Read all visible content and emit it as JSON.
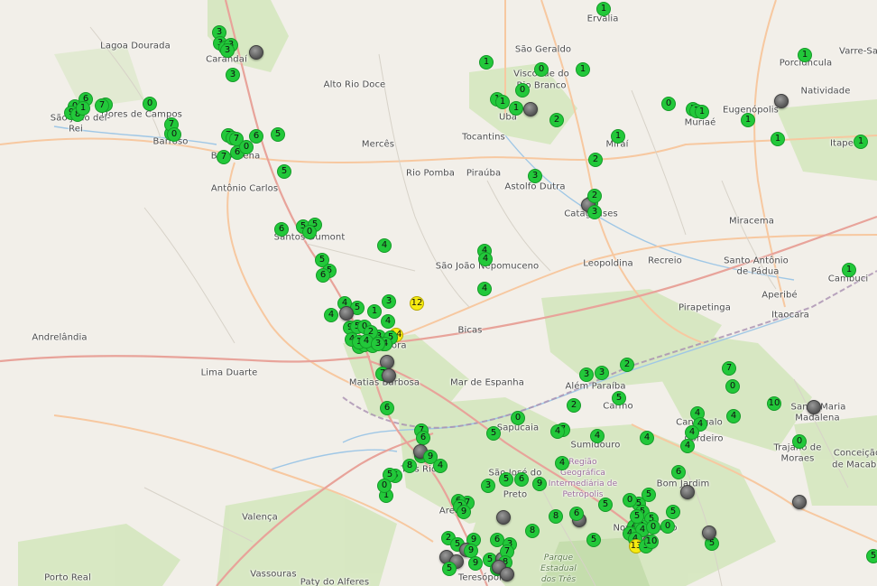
{
  "map": {
    "colors": {
      "land": "#f2efe9",
      "forest": "#cfe5b5",
      "road_major": "#e8a39a",
      "road_trunk": "#f7c8a0",
      "river": "#9fc7e6",
      "boundary": "#9e8ea6",
      "marker_green": "#22c83a",
      "marker_yellow": "#f6ea10",
      "marker_gray": "#5e5e5e"
    },
    "places": [
      {
        "name": "Lagoa Dourada"
      },
      {
        "name": "Carandaí"
      },
      {
        "name": "Alto Rio Doce"
      },
      {
        "name": "São Geraldo"
      },
      {
        "name": "Ervália"
      },
      {
        "name": "Porciúncula"
      },
      {
        "name": "Varre-Sai"
      },
      {
        "name": "Natividade"
      },
      {
        "name": "Visconde do Rio Branco"
      },
      {
        "name": "Dores de Campos"
      },
      {
        "name": "São João del-Rei"
      },
      {
        "name": "Barroso"
      },
      {
        "name": "Barbacena"
      },
      {
        "name": "Mercês"
      },
      {
        "name": "Tocantins"
      },
      {
        "name": "Ubá"
      },
      {
        "name": "Miraí"
      },
      {
        "name": "Muriaé"
      },
      {
        "name": "Eugenópolis"
      },
      {
        "name": "Itaperuna"
      },
      {
        "name": "Rio Pomba"
      },
      {
        "name": "Piraúba"
      },
      {
        "name": "Astolfo Dutra"
      },
      {
        "name": "Antônio Carlos"
      },
      {
        "name": "Cataguases"
      },
      {
        "name": "Miracema"
      },
      {
        "name": "Santos Dumont"
      },
      {
        "name": "São João Nepomuceno"
      },
      {
        "name": "Leopoldina"
      },
      {
        "name": "Recreio"
      },
      {
        "name": "Santo Antônio de Pádua"
      },
      {
        "name": "Cambuci"
      },
      {
        "name": "Aperibé"
      },
      {
        "name": "Itaocara"
      },
      {
        "name": "Pirapetinga"
      },
      {
        "name": "Andrelândia"
      },
      {
        "name": "Bicas"
      },
      {
        "name": "Juiz de Fora"
      },
      {
        "name": "Lima Duarte"
      },
      {
        "name": "Matias Barbosa"
      },
      {
        "name": "Mar de Espanha"
      },
      {
        "name": "Além Paraíba"
      },
      {
        "name": "Carmo"
      },
      {
        "name": "Santa Maria Madalena"
      },
      {
        "name": "Sapucaia"
      },
      {
        "name": "Cantagalo"
      },
      {
        "name": "Cordeiro"
      },
      {
        "name": "Sumidouro"
      },
      {
        "name": "Trajano de Moraes"
      },
      {
        "name": "Conceição de Macabu"
      },
      {
        "name": "Três Rios"
      },
      {
        "name": "São José do Vale do Rio Preto"
      },
      {
        "name": "Região Geográfica Intermediária de Petrópolis"
      },
      {
        "name": "Bom Jardim"
      },
      {
        "name": "Areal"
      },
      {
        "name": "Nova Friburgo"
      },
      {
        "name": "Valença"
      },
      {
        "name": "Vassouras"
      },
      {
        "name": "Porto Real"
      },
      {
        "name": "Paty do Alferes"
      },
      {
        "name": "Teresópolis"
      },
      {
        "name": "Petrópolis"
      },
      {
        "name": "Parque Estadual dos Três Picos"
      }
    ],
    "place_labels": [
      "Lagoa Dourada",
      "Carandaí",
      "Alto Rio Doce",
      "São Geraldo",
      "Ervália",
      "Porciúncula",
      "Varre-Sai",
      "Natividade",
      "Visconde do",
      "Rio Branco",
      "Dores de Campos",
      "São João del-",
      "Rei",
      "Barroso",
      "Barbacena",
      "Mercês",
      "Tocantins",
      "Ubá",
      "Miraí",
      "Muriaé",
      "Eugenópolis",
      "Itape",
      "Rio Pomba",
      "Piraúba",
      "Astolfo Dutra",
      "Antônio Carlos",
      "Cataguases",
      "Miracema",
      "Santos Dumont",
      "São João Nepomuceno",
      "Leopoldina",
      "Recreio",
      "Santo Antônio",
      "de Pádua",
      "Cambuci",
      "Aperibé",
      "Itaocara",
      "Pirapetinga",
      "Andrelândia",
      "Bicas",
      "Juiz de Fora",
      "Lima Duarte",
      "Matias Barbosa",
      "Mar de Espanha",
      "Além Paraíba",
      "Carmo",
      "Santa Maria",
      "Madalena",
      "Sapucaia",
      "Cantagalo",
      "Cordeiro",
      "Sumidouro",
      "Trajano de",
      "Moraes",
      "Conceição",
      "de Macabu",
      "Três Rios",
      "São José do",
      "Preto",
      "Região",
      "Geográfica",
      "Intermediária de",
      "Petrópolis",
      "Bom Jardim",
      "Areal",
      "Nova Friburgo",
      "Valença",
      "Vassouras",
      "Porto Real",
      "Paty do Alferes",
      "Teresópolis",
      "Parque",
      "Estadual",
      "dos Três"
    ],
    "markers": [
      {
        "label": "3",
        "color": "green"
      },
      {
        "label": "3",
        "color": "green"
      },
      {
        "label": "3",
        "color": "green"
      },
      {
        "label": "3",
        "color": "green"
      },
      {
        "label": "3",
        "color": "green"
      },
      {
        "label": "",
        "color": "gray"
      },
      {
        "label": "3",
        "color": "green"
      },
      {
        "label": "1",
        "color": "green"
      },
      {
        "label": "0",
        "color": "green"
      },
      {
        "label": "1",
        "color": "green"
      },
      {
        "label": "1",
        "color": "green"
      },
      {
        "label": "1",
        "color": "green"
      },
      {
        "label": "0",
        "color": "green"
      },
      {
        "label": "1",
        "color": "green"
      },
      {
        "label": "",
        "color": "gray"
      },
      {
        "label": "2",
        "color": "green"
      },
      {
        "label": "1",
        "color": "green"
      },
      {
        "label": "2",
        "color": "green"
      },
      {
        "label": "0",
        "color": "green"
      },
      {
        "label": "1",
        "color": "green"
      },
      {
        "label": "1",
        "color": "green"
      },
      {
        "label": "1",
        "color": "green"
      },
      {
        "label": "1",
        "color": "green"
      },
      {
        "label": "1",
        "color": "green"
      },
      {
        "label": "",
        "color": "gray"
      },
      {
        "label": "1",
        "color": "green"
      },
      {
        "label": "1",
        "color": "green"
      },
      {
        "label": "1",
        "color": "green"
      },
      {
        "label": "6",
        "color": "green"
      },
      {
        "label": "0",
        "color": "green"
      },
      {
        "label": "9",
        "color": "green"
      },
      {
        "label": "8",
        "color": "green"
      },
      {
        "label": "1",
        "color": "green"
      },
      {
        "label": "0",
        "color": "green"
      },
      {
        "label": "7",
        "color": "green"
      },
      {
        "label": "0",
        "color": "green"
      },
      {
        "label": "0",
        "color": "green"
      },
      {
        "label": "7",
        "color": "green"
      },
      {
        "label": "0",
        "color": "green"
      },
      {
        "label": "7",
        "color": "green"
      },
      {
        "label": "3",
        "color": "green"
      },
      {
        "label": "7",
        "color": "green"
      },
      {
        "label": "6",
        "color": "green"
      },
      {
        "label": "5",
        "color": "green"
      },
      {
        "label": "7",
        "color": "green"
      },
      {
        "label": "6",
        "color": "green"
      },
      {
        "label": "0",
        "color": "green"
      },
      {
        "label": "5",
        "color": "green"
      },
      {
        "label": "3",
        "color": "green"
      },
      {
        "label": "2",
        "color": "green"
      },
      {
        "label": "",
        "color": "gray"
      },
      {
        "label": "2",
        "color": "green"
      },
      {
        "label": "3",
        "color": "green"
      },
      {
        "label": "1",
        "color": "green"
      },
      {
        "label": "6",
        "color": "green"
      },
      {
        "label": "5",
        "color": "green"
      },
      {
        "label": "5",
        "color": "green"
      },
      {
        "label": "0",
        "color": "green"
      },
      {
        "label": "4",
        "color": "green"
      },
      {
        "label": "4",
        "color": "green"
      },
      {
        "label": "4",
        "color": "green"
      },
      {
        "label": "4",
        "color": "green"
      },
      {
        "label": "5",
        "color": "green"
      },
      {
        "label": "5",
        "color": "green"
      },
      {
        "label": "6",
        "color": "green"
      },
      {
        "label": "4",
        "color": "green"
      },
      {
        "label": "4",
        "color": "green"
      },
      {
        "label": "5",
        "color": "green"
      },
      {
        "label": "1",
        "color": "green"
      },
      {
        "label": "3",
        "color": "green"
      },
      {
        "label": "4",
        "color": "green"
      },
      {
        "label": "12",
        "color": "yellow"
      },
      {
        "label": "9",
        "color": "green"
      },
      {
        "label": "",
        "color": "gray"
      },
      {
        "label": "5",
        "color": "green"
      },
      {
        "label": "0",
        "color": "green"
      },
      {
        "label": "4",
        "color": "green"
      },
      {
        "label": "4",
        "color": "green"
      },
      {
        "label": "5",
        "color": "green"
      },
      {
        "label": "6",
        "color": "green"
      },
      {
        "label": "3",
        "color": "green"
      },
      {
        "label": "14",
        "color": "yellow"
      },
      {
        "label": "1",
        "color": "green"
      },
      {
        "label": "2",
        "color": "green"
      },
      {
        "label": "4",
        "color": "green"
      },
      {
        "label": "0",
        "color": "green"
      },
      {
        "label": "5",
        "color": "green"
      },
      {
        "label": "4",
        "color": "green"
      },
      {
        "label": "3",
        "color": "green"
      },
      {
        "label": "",
        "color": "gray"
      },
      {
        "label": "7",
        "color": "green"
      },
      {
        "label": "",
        "color": "gray"
      },
      {
        "label": "6",
        "color": "green"
      },
      {
        "label": "2",
        "color": "green"
      },
      {
        "label": "3",
        "color": "green"
      },
      {
        "label": "3",
        "color": "green"
      },
      {
        "label": "2",
        "color": "green"
      },
      {
        "label": "5",
        "color": "green"
      },
      {
        "label": "7",
        "color": "green"
      },
      {
        "label": "0",
        "color": "green"
      },
      {
        "label": "10",
        "color": "green"
      },
      {
        "label": "",
        "color": "gray"
      },
      {
        "label": "0",
        "color": "green"
      },
      {
        "label": "4",
        "color": "green"
      },
      {
        "label": "4",
        "color": "green"
      },
      {
        "label": "4",
        "color": "green"
      },
      {
        "label": "4",
        "color": "green"
      },
      {
        "label": "4",
        "color": "green"
      },
      {
        "label": "4",
        "color": "green"
      },
      {
        "label": "4",
        "color": "green"
      },
      {
        "label": "5",
        "color": "green"
      },
      {
        "label": "5",
        "color": "green"
      },
      {
        "label": "5",
        "color": "green"
      },
      {
        "label": "0",
        "color": "green"
      },
      {
        "label": "5",
        "color": "green"
      },
      {
        "label": "0",
        "color": "green"
      },
      {
        "label": "",
        "color": "gray"
      },
      {
        "label": "",
        "color": "gray"
      },
      {
        "label": "5",
        "color": "green"
      },
      {
        "label": "",
        "color": "gray"
      },
      {
        "label": "6",
        "color": "green"
      },
      {
        "label": "",
        "color": "gray"
      },
      {
        "label": "7",
        "color": "green"
      },
      {
        "label": "4",
        "color": "green"
      },
      {
        "label": "8",
        "color": "green"
      },
      {
        "label": "",
        "color": "gray"
      },
      {
        "label": "6",
        "color": "green"
      },
      {
        "label": "5",
        "color": "green"
      },
      {
        "label": "5",
        "color": "green"
      },
      {
        "label": "4",
        "color": "green"
      },
      {
        "label": "4",
        "color": "green"
      },
      {
        "label": "4",
        "color": "green"
      },
      {
        "label": "4",
        "color": "green"
      },
      {
        "label": "4",
        "color": "green"
      },
      {
        "label": "4",
        "color": "green"
      },
      {
        "label": "13",
        "color": "yellow"
      },
      {
        "label": "5",
        "color": "green"
      },
      {
        "label": "10",
        "color": "green"
      },
      {
        "label": "5",
        "color": "green"
      },
      {
        "label": "0",
        "color": "green"
      },
      {
        "label": "5",
        "color": "green"
      },
      {
        "label": "",
        "color": "gray"
      },
      {
        "label": "5",
        "color": "green"
      },
      {
        "label": "0",
        "color": "green"
      },
      {
        "label": "5",
        "color": "green"
      },
      {
        "label": "7",
        "color": "green"
      },
      {
        "label": "6",
        "color": "green"
      },
      {
        "label": "7",
        "color": "green"
      },
      {
        "label": "",
        "color": "gray"
      },
      {
        "label": "8",
        "color": "green"
      },
      {
        "label": "4",
        "color": "green"
      },
      {
        "label": "9",
        "color": "green"
      },
      {
        "label": "6",
        "color": "green"
      },
      {
        "label": "1",
        "color": "green"
      },
      {
        "label": "5",
        "color": "green"
      },
      {
        "label": "0",
        "color": "green"
      },
      {
        "label": "6",
        "color": "green"
      },
      {
        "label": "5",
        "color": "green"
      },
      {
        "label": "3",
        "color": "green"
      },
      {
        "label": "7",
        "color": "green"
      },
      {
        "label": "6",
        "color": "green"
      },
      {
        "label": "2",
        "color": "green"
      },
      {
        "label": "9",
        "color": "green"
      },
      {
        "label": "",
        "color": "gray"
      },
      {
        "label": "8",
        "color": "green"
      },
      {
        "label": "9",
        "color": "green"
      },
      {
        "label": "9",
        "color": "green"
      },
      {
        "label": "6",
        "color": "green"
      },
      {
        "label": "3",
        "color": "green"
      },
      {
        "label": "2",
        "color": "green"
      },
      {
        "label": "5",
        "color": "green"
      },
      {
        "label": "",
        "color": "gray"
      },
      {
        "label": "",
        "color": "gray"
      },
      {
        "label": "",
        "color": "gray"
      },
      {
        "label": "5",
        "color": "green"
      },
      {
        "label": "9",
        "color": "green"
      },
      {
        "label": "9",
        "color": "green"
      },
      {
        "label": "5",
        "color": "green"
      },
      {
        "label": "",
        "color": "gray"
      },
      {
        "label": "7",
        "color": "green"
      },
      {
        "label": "8",
        "color": "green"
      },
      {
        "label": "5",
        "color": "green"
      },
      {
        "label": "",
        "color": "gray"
      },
      {
        "label": "",
        "color": "gray"
      }
    ]
  }
}
